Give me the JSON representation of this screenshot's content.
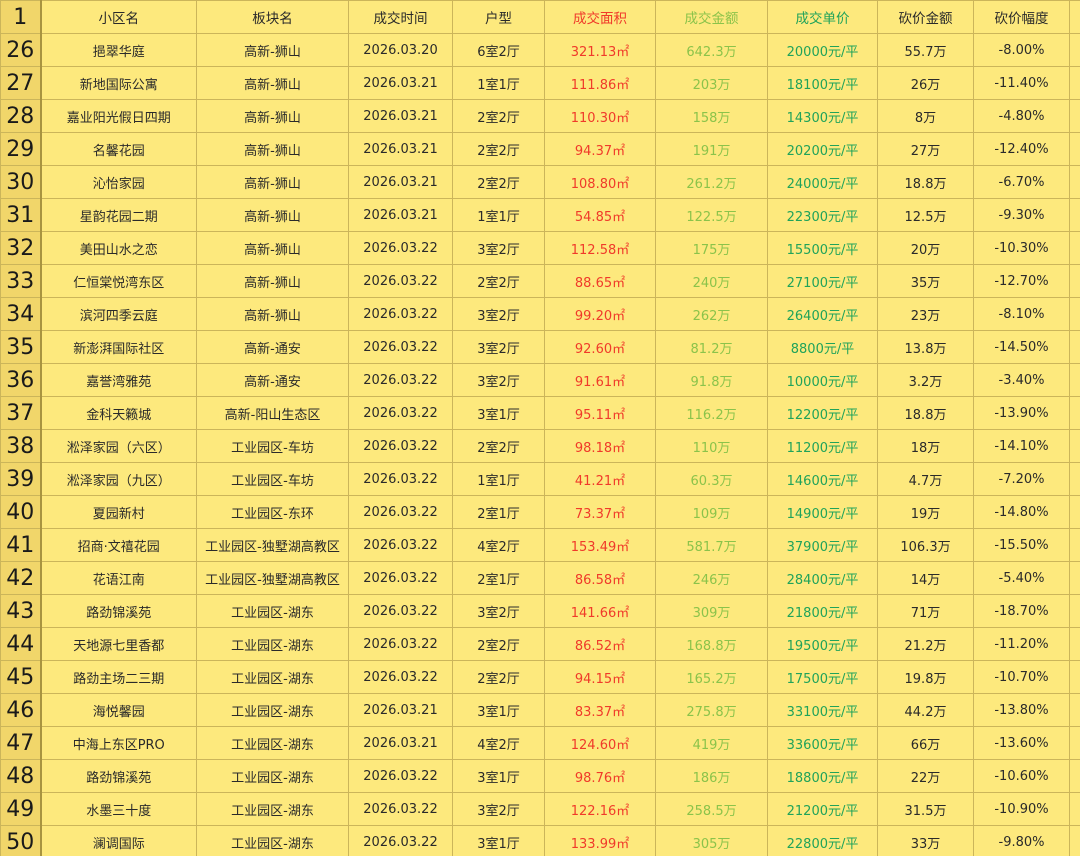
{
  "header": {
    "row_number": "1",
    "columns": [
      "小区名",
      "板块名",
      "成交时间",
      "户型",
      "成交面积",
      "成交金额",
      "成交单价",
      "砍价金额",
      "砍价幅度"
    ]
  },
  "rows": [
    {
      "n": "26",
      "name": "挹翠华庭",
      "area": "高新-狮山",
      "date": "2026.03.20",
      "type": "6室2厅",
      "size": "321.13㎡",
      "amount": "642.3万",
      "unit": "20000元/平",
      "cut": "55.7万",
      "pct": "-8.00%"
    },
    {
      "n": "27",
      "name": "新地国际公寓",
      "area": "高新-狮山",
      "date": "2026.03.21",
      "type": "1室1厅",
      "size": "111.86㎡",
      "amount": "203万",
      "unit": "18100元/平",
      "cut": "26万",
      "pct": "-11.40%"
    },
    {
      "n": "28",
      "name": "嘉业阳光假日四期",
      "area": "高新-狮山",
      "date": "2026.03.21",
      "type": "2室2厅",
      "size": "110.30㎡",
      "amount": "158万",
      "unit": "14300元/平",
      "cut": "8万",
      "pct": "-4.80%"
    },
    {
      "n": "29",
      "name": "名馨花园",
      "area": "高新-狮山",
      "date": "2026.03.21",
      "type": "2室2厅",
      "size": "94.37㎡",
      "amount": "191万",
      "unit": "20200元/平",
      "cut": "27万",
      "pct": "-12.40%"
    },
    {
      "n": "30",
      "name": "沁怡家园",
      "area": "高新-狮山",
      "date": "2026.03.21",
      "type": "2室2厅",
      "size": "108.80㎡",
      "amount": "261.2万",
      "unit": "24000元/平",
      "cut": "18.8万",
      "pct": "-6.70%"
    },
    {
      "n": "31",
      "name": "星韵花园二期",
      "area": "高新-狮山",
      "date": "2026.03.21",
      "type": "1室1厅",
      "size": "54.85㎡",
      "amount": "122.5万",
      "unit": "22300元/平",
      "cut": "12.5万",
      "pct": "-9.30%"
    },
    {
      "n": "32",
      "name": "美田山水之恋",
      "area": "高新-狮山",
      "date": "2026.03.22",
      "type": "3室2厅",
      "size": "112.58㎡",
      "amount": "175万",
      "unit": "15500元/平",
      "cut": "20万",
      "pct": "-10.30%"
    },
    {
      "n": "33",
      "name": "仁恒棠悦湾东区",
      "area": "高新-狮山",
      "date": "2026.03.22",
      "type": "2室2厅",
      "size": "88.65㎡",
      "amount": "240万",
      "unit": "27100元/平",
      "cut": "35万",
      "pct": "-12.70%"
    },
    {
      "n": "34",
      "name": "滨河四季云庭",
      "area": "高新-狮山",
      "date": "2026.03.22",
      "type": "3室2厅",
      "size": "99.20㎡",
      "amount": "262万",
      "unit": "26400元/平",
      "cut": "23万",
      "pct": "-8.10%"
    },
    {
      "n": "35",
      "name": "新澎湃国际社区",
      "area": "高新-通安",
      "date": "2026.03.22",
      "type": "3室2厅",
      "size": "92.60㎡",
      "amount": "81.2万",
      "unit": "8800元/平",
      "cut": "13.8万",
      "pct": "-14.50%"
    },
    {
      "n": "36",
      "name": "嘉誉湾雅苑",
      "area": "高新-通安",
      "date": "2026.03.22",
      "type": "3室2厅",
      "size": "91.61㎡",
      "amount": "91.8万",
      "unit": "10000元/平",
      "cut": "3.2万",
      "pct": "-3.40%"
    },
    {
      "n": "37",
      "name": "金科天籁城",
      "area": "高新-阳山生态区",
      "date": "2026.03.22",
      "type": "3室1厅",
      "size": "95.11㎡",
      "amount": "116.2万",
      "unit": "12200元/平",
      "cut": "18.8万",
      "pct": "-13.90%"
    },
    {
      "n": "38",
      "name": "淞泽家园（六区）",
      "area": "工业园区-车坊",
      "date": "2026.03.22",
      "type": "2室2厅",
      "size": "98.18㎡",
      "amount": "110万",
      "unit": "11200元/平",
      "cut": "18万",
      "pct": "-14.10%"
    },
    {
      "n": "39",
      "name": "淞泽家园（九区）",
      "area": "工业园区-车坊",
      "date": "2026.03.22",
      "type": "1室1厅",
      "size": "41.21㎡",
      "amount": "60.3万",
      "unit": "14600元/平",
      "cut": "4.7万",
      "pct": "-7.20%"
    },
    {
      "n": "40",
      "name": "夏园新村",
      "area": "工业园区-东环",
      "date": "2026.03.22",
      "type": "2室1厅",
      "size": "73.37㎡",
      "amount": "109万",
      "unit": "14900元/平",
      "cut": "19万",
      "pct": "-14.80%"
    },
    {
      "n": "41",
      "name": "招商·文禧花园",
      "area": "工业园区-独墅湖高教区",
      "date": "2026.03.22",
      "type": "4室2厅",
      "size": "153.49㎡",
      "amount": "581.7万",
      "unit": "37900元/平",
      "cut": "106.3万",
      "pct": "-15.50%"
    },
    {
      "n": "42",
      "name": "花语江南",
      "area": "工业园区-独墅湖高教区",
      "date": "2026.03.22",
      "type": "2室1厅",
      "size": "86.58㎡",
      "amount": "246万",
      "unit": "28400元/平",
      "cut": "14万",
      "pct": "-5.40%"
    },
    {
      "n": "43",
      "name": "路劲锦溪苑",
      "area": "工业园区-湖东",
      "date": "2026.03.22",
      "type": "3室2厅",
      "size": "141.66㎡",
      "amount": "309万",
      "unit": "21800元/平",
      "cut": "71万",
      "pct": "-18.70%"
    },
    {
      "n": "44",
      "name": "天地源七里香都",
      "area": "工业园区-湖东",
      "date": "2026.03.22",
      "type": "2室2厅",
      "size": "86.52㎡",
      "amount": "168.8万",
      "unit": "19500元/平",
      "cut": "21.2万",
      "pct": "-11.20%"
    },
    {
      "n": "45",
      "name": "路劲主场二三期",
      "area": "工业园区-湖东",
      "date": "2026.03.22",
      "type": "2室2厅",
      "size": "94.15㎡",
      "amount": "165.2万",
      "unit": "17500元/平",
      "cut": "19.8万",
      "pct": "-10.70%"
    },
    {
      "n": "46",
      "name": "海悦馨园",
      "area": "工业园区-湖东",
      "date": "2026.03.21",
      "type": "3室1厅",
      "size": "83.37㎡",
      "amount": "275.8万",
      "unit": "33100元/平",
      "cut": "44.2万",
      "pct": "-13.80%"
    },
    {
      "n": "47",
      "name": "中海上东区PRO",
      "area": "工业园区-湖东",
      "date": "2026.03.21",
      "type": "4室2厅",
      "size": "124.60㎡",
      "amount": "419万",
      "unit": "33600元/平",
      "cut": "66万",
      "pct": "-13.60%"
    },
    {
      "n": "48",
      "name": "路劲锦溪苑",
      "area": "工业园区-湖东",
      "date": "2026.03.22",
      "type": "3室1厅",
      "size": "98.76㎡",
      "amount": "186万",
      "unit": "18800元/平",
      "cut": "22万",
      "pct": "-10.60%"
    },
    {
      "n": "49",
      "name": "水墨三十度",
      "area": "工业园区-湖东",
      "date": "2026.03.22",
      "type": "3室2厅",
      "size": "122.16㎡",
      "amount": "258.5万",
      "unit": "21200元/平",
      "cut": "31.5万",
      "pct": "-10.90%"
    },
    {
      "n": "50",
      "name": "澜调国际",
      "area": "工业园区-湖东",
      "date": "2026.03.22",
      "type": "3室1厅",
      "size": "133.99㎡",
      "amount": "305万",
      "unit": "22800元/平",
      "cut": "33万",
      "pct": "-9.80%"
    }
  ]
}
